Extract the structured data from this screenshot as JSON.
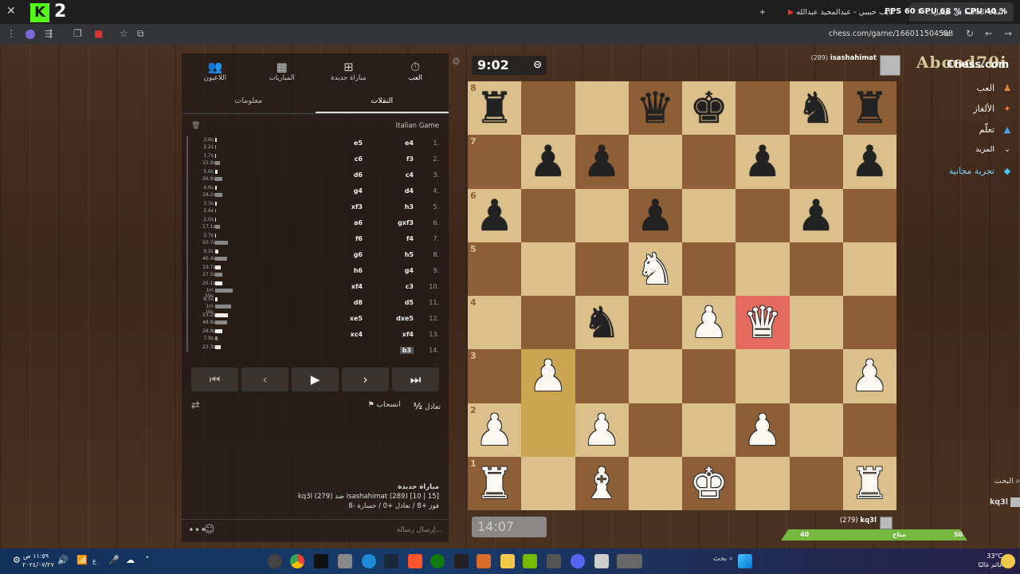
{
  "browser": {
    "tabs": [
      {
        "title": "القناة الخاصة بي هيفيل...",
        "active": true
      },
      {
        "title": "غايب حبيبي - عبدالمجيد عبدالله",
        "active": false
      }
    ],
    "new_tab": "+",
    "perf": "FPS 60  GPU 68 %  CPU 40 %",
    "url": "chess.com/game/166011504598",
    "kick_number": "2"
  },
  "top_player": {
    "name": "isashahimat",
    "rating": "(289)",
    "watermark": "Abood70i",
    "clock": "9:02"
  },
  "bottom_player": {
    "name": "kq3l",
    "rating": "(279)",
    "clock": "14:07",
    "bar_left": "40",
    "bar_mid": "متاح",
    "bar_right": "50"
  },
  "panel": {
    "nav": [
      "العب",
      "مباراة جديدة",
      "المباريات",
      "اللاعبون"
    ],
    "subtabs": [
      "النقلات",
      "معلومات"
    ],
    "opening": "Italian Game",
    "actions": {
      "draw": "تعادل",
      "half": "½",
      "resign": "انسحاب"
    },
    "game_info": {
      "title": "مباراة جديدة",
      "line1": "kq3l (279) ضد isashahimat (289) [10 | 15]",
      "line2": "فوز +8 / تعادل +0 / خسارة -8"
    },
    "chat_placeholder": "إرسال رسالة..."
  },
  "moves": [
    {
      "n": "1.",
      "w": "e4",
      "b": "e5",
      "tw": "3.6s",
      "tb": "2.2s",
      "bw": 2,
      "bb": 1
    },
    {
      "n": "2.",
      "w": "f3",
      "b": "c6",
      "tw": "1.7s",
      "tb": "15.9s",
      "bw": 1,
      "bb": 6
    },
    {
      "n": "3.",
      "w": "c4",
      "b": "d6",
      "tw": "5.6s",
      "tb": "26.9s",
      "bw": 3,
      "bb": 9
    },
    {
      "n": "4.",
      "w": "d4",
      "b": "g4",
      "tw": "4.6s",
      "tb": "28.2s",
      "bw": 2,
      "bb": 9
    },
    {
      "n": "5.",
      "w": "h3",
      "b": "xf3",
      "tw": "3.3s",
      "tb": "2.6s",
      "bw": 2,
      "bb": 1
    },
    {
      "n": "6.",
      "w": "gxf3",
      "b": "a6",
      "tw": "2.0s",
      "tb": "17.1s",
      "bw": 1,
      "bb": 6
    },
    {
      "n": "7.",
      "w": "f4",
      "b": "f6",
      "tw": "2.7s",
      "tb": "50.7s",
      "bw": 1,
      "bb": 16
    },
    {
      "n": "8.",
      "w": "h5",
      "b": "g6",
      "tw": "9.2s",
      "tb": "46.4s",
      "bw": 4,
      "bb": 15
    },
    {
      "n": "9.",
      "w": "g4",
      "b": "h6",
      "tw": "19.7s",
      "tb": "27.5s",
      "bw": 7,
      "bb": 9
    },
    {
      "n": "10.",
      "w": "c3",
      "b": "xf4",
      "tw": "26.1s",
      "tb": "1m 59s",
      "bw": 9,
      "bb": 22
    },
    {
      "n": "11.",
      "w": "d5",
      "b": "d8",
      "tw": "8.5s",
      "tb": "1m 19s",
      "bw": 3,
      "bb": 20
    },
    {
      "n": "12.",
      "w": "dxe5",
      "b": "xe5",
      "tw": "53.2s",
      "tb": "48.8s",
      "bw": 16,
      "bb": 15
    },
    {
      "n": "13.",
      "w": "xf4",
      "b": "xc4",
      "tw": "28.8s",
      "tb": "7.9s",
      "bw": 9,
      "bb": 3
    },
    {
      "n": "14.",
      "w": "b3",
      "b": "",
      "tw": "23.3s",
      "tb": "",
      "bw": 7,
      "bb": 0
    }
  ],
  "board": {
    "files": [
      "a",
      "b",
      "c",
      "d",
      "e",
      "f",
      "g",
      "h"
    ],
    "ranks": [
      "8",
      "7",
      "6",
      "5",
      "4",
      "3",
      "2",
      "1"
    ],
    "position": [
      [
        "bR",
        "",
        "",
        "bQ",
        "bK",
        "",
        "bN",
        "bR"
      ],
      [
        "",
        "bP",
        "bP",
        "",
        "",
        "bP",
        "",
        "bP"
      ],
      [
        "bP",
        "",
        "",
        "bP",
        "",
        "",
        "bP",
        ""
      ],
      [
        "",
        "",
        "",
        "wN",
        "",
        "",
        "",
        ""
      ],
      [
        "",
        "",
        "bN",
        "",
        "wP",
        "wQ",
        "",
        ""
      ],
      [
        "",
        "wP",
        "",
        "",
        "",
        "",
        "",
        "wP"
      ],
      [
        "wP",
        "",
        "wP",
        "",
        "",
        "wP",
        "",
        ""
      ],
      [
        "wR",
        "",
        "wB",
        "",
        "wK",
        "",
        "",
        "wR"
      ]
    ],
    "highlight": [
      "b2",
      "b3"
    ],
    "check_square": "f4"
  },
  "right_nav": {
    "logo": "Chess.com",
    "items": [
      "العب",
      "الألغاز",
      "تعلّم",
      "المزيد",
      "تجربة مجانية"
    ],
    "search": "البحث",
    "user": "kq3l"
  },
  "taskbar": {
    "search": "بحث",
    "time": "١١:٥٩ ص",
    "date": "٢٠٢٤/٠٧/٢٧",
    "weather_temp": "33°C",
    "weather_text": "غائم غالبًا",
    "lang": "ع"
  },
  "colors": {
    "light_square": "#dbc08b",
    "dark_square": "#8e5f36",
    "check": "#e56a5e",
    "accent_green": "#75b83f"
  }
}
